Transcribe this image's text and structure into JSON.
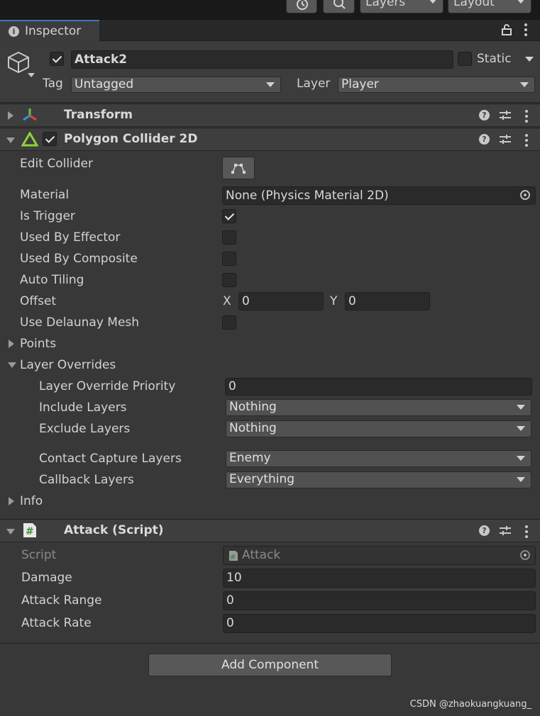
{
  "toolbar": {
    "layers_label": "Layers",
    "layout_label": "Layout"
  },
  "tab": {
    "title": "Inspector"
  },
  "gameobject": {
    "name": "Attack2",
    "active": true,
    "static_label": "Static",
    "tag_label": "Tag",
    "tag_value": "Untagged",
    "layer_label": "Layer",
    "layer_value": "Player"
  },
  "components": {
    "transform": {
      "title": "Transform"
    },
    "collider": {
      "title": "Polygon Collider 2D",
      "edit_collider_label": "Edit Collider",
      "material_label": "Material",
      "material_value": "None (Physics Material 2D)",
      "is_trigger_label": "Is Trigger",
      "is_trigger": true,
      "used_by_effector_label": "Used By Effector",
      "used_by_composite_label": "Used By Composite",
      "auto_tiling_label": "Auto Tiling",
      "offset_label": "Offset",
      "offset_x_label": "X",
      "offset_x": "0",
      "offset_y_label": "Y",
      "offset_y": "0",
      "use_delaunay_label": "Use Delaunay Mesh",
      "points_label": "Points",
      "layer_overrides_label": "Layer Overrides",
      "layer_override_priority_label": "Layer Override Priority",
      "layer_override_priority": "0",
      "include_layers_label": "Include Layers",
      "include_layers": "Nothing",
      "exclude_layers_label": "Exclude Layers",
      "exclude_layers": "Nothing",
      "contact_capture_label": "Contact Capture Layers",
      "contact_capture": "Enemy",
      "callback_label": "Callback Layers",
      "callback": "Everything",
      "info_label": "Info"
    },
    "script": {
      "title": "Attack (Script)",
      "script_label": "Script",
      "script_value": "Attack",
      "damage_label": "Damage",
      "damage": "10",
      "attack_range_label": "Attack Range",
      "attack_range": "0",
      "attack_rate_label": "Attack Rate",
      "attack_rate": "0"
    }
  },
  "add_component_label": "Add Component",
  "watermark": "CSDN @zhaokuangkuang_"
}
